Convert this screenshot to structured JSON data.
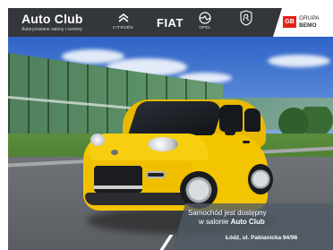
{
  "header": {
    "dealer_name": "Auto Club",
    "dealer_tagline": "Autoryzowane salony i serwisy",
    "brands": [
      {
        "icon": "citroen-logo-icon",
        "label": "CITROËN"
      },
      {
        "icon": "fiat-logo-icon",
        "label": "FIAT"
      },
      {
        "icon": "opel-logo-icon",
        "label": "OPEL"
      },
      {
        "icon": "peugeot-logo-icon",
        "label": ""
      }
    ],
    "group": {
      "badge": "GB",
      "line1": "GRUPA",
      "line2": "BEMO"
    }
  },
  "photo": {
    "subject": "car-photo"
  },
  "promo": {
    "line1": "Samochód jest dostępny",
    "line2_prefix": "w salonie ",
    "line2_highlight": "Auto Club",
    "address": "Łódź, ul. Pabianicka 94/96"
  },
  "colors": {
    "header_bg": "#33363a",
    "accent_red": "#e2231a",
    "car_yellow": "#f3c400"
  }
}
